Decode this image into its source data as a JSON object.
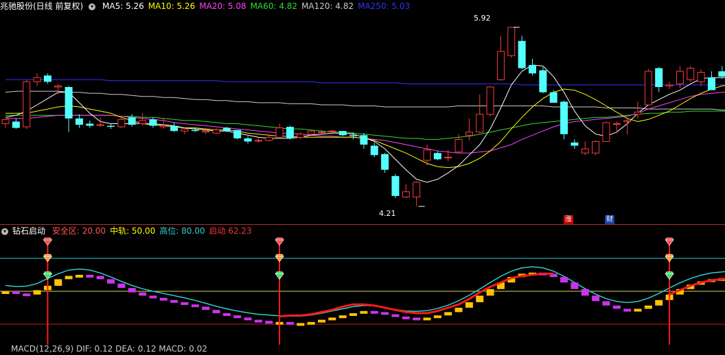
{
  "header": {
    "stock_title": "兆驰股份(日线 前复权)",
    "ma_items": [
      {
        "label": "MA5: 5.26",
        "color": "#ffffff"
      },
      {
        "label": "MA10: 5.26",
        "color": "#ffff00"
      },
      {
        "label": "MA20: 5.08",
        "color": "#ff44ff"
      },
      {
        "label": "MA60: 4.82",
        "color": "#33dd33"
      },
      {
        "label": "MA120: 4.82",
        "color": "#cccccc"
      },
      {
        "label": "MA250: 5.03",
        "color": "#3333ff"
      }
    ]
  },
  "indicator_header": {
    "name": "钻石启动",
    "items": [
      {
        "label": "安全区: 20.00",
        "color": "#ff5555"
      },
      {
        "label": "中轨: 50.00",
        "color": "#ffff00"
      },
      {
        "label": "高位: 80.00",
        "color": "#33cccc"
      },
      {
        "label": "启动  62.23",
        "color": "#ff3333"
      }
    ]
  },
  "bottom_header": {
    "text": "MACD(12,26,9) DIF: 0.12  DEA: 0.12  MACD: 0.02"
  },
  "annotations": {
    "high_label": "5.92",
    "low_label": "4.21",
    "badge_zhang": "涨",
    "badge_cai": "财"
  },
  "chart_data": [
    {
      "type": "candlestick",
      "title": "兆驰股份(日线 前复权)",
      "ylim": [
        4.1,
        6.05
      ],
      "candles": [
        [
          5.0,
          5.04,
          4.96,
          5.02
        ],
        [
          5.02,
          4.96,
          4.95,
          5.05
        ],
        [
          4.97,
          5.4,
          4.95,
          5.42
        ],
        [
          5.4,
          5.44,
          5.36,
          5.48
        ],
        [
          5.46,
          5.4,
          5.38,
          5.48
        ],
        [
          5.35,
          5.36,
          5.28,
          5.38
        ],
        [
          5.35,
          5.05,
          4.92,
          5.36
        ],
        [
          5.05,
          4.99,
          4.96,
          5.09
        ],
        [
          5.0,
          4.98,
          4.96,
          5.03
        ],
        [
          4.99,
          4.99,
          4.97,
          5.06
        ],
        [
          4.98,
          4.97,
          4.95,
          5.0
        ],
        [
          4.97,
          5.04,
          4.96,
          5.06
        ],
        [
          5.06,
          4.99,
          4.97,
          5.09
        ],
        [
          5.0,
          5.03,
          4.98,
          5.1
        ],
        [
          5.04,
          4.98,
          4.96,
          5.06
        ],
        [
          4.97,
          4.98,
          4.95,
          5.05
        ],
        [
          4.98,
          4.93,
          4.92,
          5.01
        ],
        [
          4.93,
          4.95,
          4.9,
          4.96
        ],
        [
          4.94,
          4.93,
          4.92,
          4.96
        ],
        [
          4.92,
          4.93,
          4.9,
          4.96
        ],
        [
          4.91,
          4.94,
          4.9,
          4.96
        ],
        [
          4.96,
          4.93,
          4.92,
          4.97
        ],
        [
          4.94,
          4.86,
          4.85,
          4.94
        ],
        [
          4.86,
          4.83,
          4.81,
          4.88
        ],
        [
          4.84,
          4.84,
          4.82,
          4.87
        ],
        [
          4.84,
          4.87,
          4.83,
          4.9
        ],
        [
          4.87,
          4.96,
          4.86,
          5.0
        ],
        [
          4.97,
          4.86,
          4.85,
          4.98
        ],
        [
          4.87,
          4.9,
          4.85,
          4.92
        ],
        [
          4.9,
          4.93,
          4.89,
          4.94
        ],
        [
          4.92,
          4.92,
          4.9,
          4.94
        ],
        [
          4.93,
          4.93,
          4.91,
          4.94
        ],
        [
          4.93,
          4.89,
          4.88,
          4.93
        ],
        [
          4.89,
          4.88,
          4.85,
          4.92
        ],
        [
          4.89,
          4.8,
          4.76,
          4.91
        ],
        [
          4.79,
          4.7,
          4.68,
          4.82
        ],
        [
          4.71,
          4.56,
          4.53,
          4.72
        ],
        [
          4.5,
          4.31,
          4.29,
          4.52
        ],
        [
          4.3,
          4.35,
          4.29,
          4.42
        ],
        [
          4.3,
          4.44,
          4.21,
          4.45
        ],
        [
          4.65,
          4.75,
          4.6,
          4.8
        ],
        [
          4.72,
          4.66,
          4.65,
          4.74
        ],
        [
          4.68,
          4.68,
          4.64,
          4.75
        ],
        [
          4.73,
          4.85,
          4.72,
          4.9
        ],
        [
          4.89,
          4.92,
          4.84,
          5.05
        ],
        [
          4.92,
          5.09,
          4.91,
          5.28
        ],
        [
          5.09,
          5.35,
          5.07,
          5.36
        ],
        [
          5.42,
          5.69,
          5.41,
          5.84
        ],
        [
          5.65,
          5.92,
          5.63,
          5.92
        ],
        [
          5.79,
          5.53,
          5.52,
          5.84
        ],
        [
          5.56,
          5.48,
          5.46,
          5.62
        ],
        [
          5.51,
          5.3,
          5.29,
          5.54
        ],
        [
          5.3,
          5.2,
          5.2,
          5.32
        ],
        [
          5.21,
          4.9,
          4.85,
          5.22
        ],
        [
          4.82,
          4.79,
          4.76,
          4.85
        ],
        [
          4.72,
          4.76,
          4.7,
          4.83
        ],
        [
          4.72,
          4.83,
          4.7,
          4.84
        ],
        [
          4.83,
          5.01,
          4.83,
          5.02
        ],
        [
          5.0,
          5.0,
          4.91,
          5.02
        ],
        [
          5.02,
          5.03,
          4.9,
          5.05
        ],
        [
          5.09,
          5.11,
          5.05,
          5.21
        ],
        [
          5.18,
          5.5,
          5.18,
          5.52
        ],
        [
          5.53,
          5.35,
          5.3,
          5.54
        ],
        [
          5.36,
          5.37,
          5.33,
          5.4
        ],
        [
          5.38,
          5.5,
          5.34,
          5.55
        ],
        [
          5.42,
          5.53,
          5.4,
          5.55
        ],
        [
          5.4,
          5.49,
          5.36,
          5.52
        ],
        [
          5.44,
          5.32,
          5.32,
          5.5
        ],
        [
          5.5,
          5.45,
          5.43,
          5.55
        ],
        [
          5.56,
          5.5,
          5.35,
          5.56
        ],
        [
          5.48,
          5.5,
          5.36,
          5.52
        ],
        [
          5.5,
          5.59,
          5.49,
          5.62
        ]
      ],
      "lines": [
        {
          "name": "MA5",
          "color": "#ffffff",
          "values": [
            5.06,
            5.08,
            5.12,
            5.18,
            5.24,
            5.3,
            5.3,
            5.2,
            5.1,
            5.02,
            5.0,
            5.0,
            5.0,
            5.0,
            5.0,
            4.99,
            4.98,
            4.96,
            4.95,
            4.94,
            4.93,
            4.93,
            4.91,
            4.89,
            4.87,
            4.86,
            4.86,
            4.86,
            4.87,
            4.89,
            4.9,
            4.91,
            4.91,
            4.9,
            4.87,
            4.83,
            4.76,
            4.66,
            4.56,
            4.47,
            4.44,
            4.47,
            4.53,
            4.6,
            4.7,
            4.8,
            4.95,
            5.15,
            5.37,
            5.5,
            5.56,
            5.55,
            5.45,
            5.3,
            5.12,
            4.98,
            4.9,
            4.88,
            4.92,
            5.0,
            5.1,
            5.18,
            5.23,
            5.28,
            5.32,
            5.38,
            5.43,
            5.44,
            5.44,
            5.44,
            5.46,
            5.49
          ]
        },
        {
          "name": "MA10",
          "color": "#ffff00",
          "values": [
            5.1,
            5.1,
            5.1,
            5.12,
            5.14,
            5.16,
            5.17,
            5.16,
            5.14,
            5.12,
            5.1,
            5.06,
            5.03,
            5.0,
            4.99,
            4.98,
            4.97,
            4.96,
            4.96,
            4.95,
            4.94,
            4.94,
            4.93,
            4.91,
            4.9,
            4.89,
            4.88,
            4.88,
            4.87,
            4.87,
            4.87,
            4.87,
            4.87,
            4.87,
            4.86,
            4.84,
            4.8,
            4.76,
            4.72,
            4.67,
            4.62,
            4.59,
            4.58,
            4.59,
            4.62,
            4.67,
            4.74,
            4.83,
            4.95,
            5.06,
            5.16,
            5.24,
            5.3,
            5.33,
            5.32,
            5.28,
            5.23,
            5.17,
            5.11,
            5.05,
            5.02,
            5.04,
            5.08,
            5.12,
            5.18,
            5.24,
            5.29,
            5.33,
            5.36,
            5.38,
            5.41,
            5.44
          ]
        },
        {
          "name": "MA20",
          "color": "#ff44ff",
          "values": [
            5.05,
            5.05,
            5.05,
            5.06,
            5.07,
            5.08,
            5.08,
            5.08,
            5.08,
            5.08,
            5.08,
            5.07,
            5.06,
            5.05,
            5.04,
            5.03,
            5.01,
            5.0,
            4.99,
            4.98,
            4.97,
            4.96,
            4.95,
            4.94,
            4.93,
            4.92,
            4.91,
            4.91,
            4.9,
            4.89,
            4.88,
            4.88,
            4.87,
            4.87,
            4.86,
            4.85,
            4.84,
            4.82,
            4.8,
            4.78,
            4.76,
            4.74,
            4.73,
            4.72,
            4.72,
            4.73,
            4.74,
            4.77,
            4.8,
            4.85,
            4.89,
            4.93,
            4.97,
            5.0,
            5.02,
            5.03,
            5.04,
            5.05,
            5.06,
            5.07,
            5.1,
            5.14,
            5.17,
            5.2,
            5.23,
            5.26,
            5.28,
            5.29,
            5.3,
            5.3,
            5.3,
            5.3
          ]
        },
        {
          "name": "MA60",
          "color": "#33dd33",
          "values": [
            5.08,
            5.08,
            5.08,
            5.08,
            5.08,
            5.08,
            5.08,
            5.08,
            5.08,
            5.08,
            5.08,
            5.07,
            5.07,
            5.06,
            5.06,
            5.05,
            5.04,
            5.03,
            5.03,
            5.02,
            5.01,
            5.0,
            5.0,
            4.99,
            4.98,
            4.97,
            4.96,
            4.95,
            4.95,
            4.94,
            4.93,
            4.92,
            4.92,
            4.91,
            4.9,
            4.89,
            4.88,
            4.87,
            4.86,
            4.86,
            4.85,
            4.85,
            4.86,
            4.87,
            4.88,
            4.9,
            4.92,
            4.94,
            4.96,
            4.98,
            5.0,
            5.01,
            5.02,
            5.03,
            5.04,
            5.05,
            5.06,
            5.06,
            5.07,
            5.08,
            5.09,
            5.1,
            5.1,
            5.11,
            5.11,
            5.12,
            5.12,
            5.12,
            5.12,
            5.12,
            5.12,
            5.13
          ]
        },
        {
          "name": "MA120",
          "color": "#cccccc",
          "values": [
            5.3,
            5.31,
            5.31,
            5.31,
            5.31,
            5.31,
            5.3,
            5.3,
            5.29,
            5.29,
            5.28,
            5.28,
            5.27,
            5.26,
            5.26,
            5.25,
            5.25,
            5.24,
            5.23,
            5.23,
            5.22,
            5.22,
            5.21,
            5.21,
            5.2,
            5.2,
            5.2,
            5.19,
            5.19,
            5.19,
            5.18,
            5.18,
            5.18,
            5.17,
            5.17,
            5.17,
            5.16,
            5.16,
            5.16,
            5.16,
            5.16,
            5.16,
            5.16,
            5.17,
            5.17,
            5.17,
            5.17,
            5.17,
            5.17,
            5.17,
            5.17,
            5.17,
            5.16,
            5.16,
            5.16,
            5.16,
            5.16,
            5.15,
            5.15,
            5.15,
            5.15,
            5.14,
            5.14,
            5.14,
            5.14,
            5.14,
            5.14,
            5.14,
            5.13,
            5.13,
            5.13,
            5.13
          ]
        },
        {
          "name": "MA250",
          "color": "#3333ff",
          "values": [
            5.42,
            5.42,
            5.42,
            5.42,
            5.42,
            5.42,
            5.42,
            5.42,
            5.42,
            5.42,
            5.41,
            5.41,
            5.41,
            5.41,
            5.41,
            5.41,
            5.41,
            5.41,
            5.41,
            5.41,
            5.41,
            5.4,
            5.4,
            5.4,
            5.4,
            5.4,
            5.4,
            5.4,
            5.4,
            5.4,
            5.39,
            5.39,
            5.39,
            5.39,
            5.39,
            5.39,
            5.39,
            5.39,
            5.38,
            5.38,
            5.38,
            5.38,
            5.38,
            5.38,
            5.38,
            5.38,
            5.38,
            5.38,
            5.38,
            5.37,
            5.37,
            5.37,
            5.37,
            5.37,
            5.37,
            5.37,
            5.37,
            5.37,
            5.37,
            5.37,
            5.37,
            5.37,
            5.37,
            5.37,
            5.37,
            5.37,
            5.37,
            5.37,
            5.37,
            5.37,
            5.37,
            5.37
          ]
        }
      ]
    },
    {
      "type": "bar",
      "title": "钻石启动",
      "ylim": [
        0,
        100
      ],
      "reference_lines": [
        20,
        50,
        80
      ],
      "values": [
        50,
        48,
        47,
        51,
        55,
        61,
        64,
        65,
        64,
        61,
        57,
        53,
        49,
        46,
        44,
        42,
        40,
        38,
        36,
        33,
        30,
        28,
        26,
        24,
        23,
        22,
        22,
        21,
        21,
        22,
        24,
        26,
        28,
        30,
        32,
        31,
        29,
        27,
        26,
        25,
        26,
        28,
        31,
        35,
        40,
        46,
        52,
        58,
        63,
        66,
        67,
        66,
        63,
        58,
        52,
        46,
        41,
        37,
        34,
        33,
        34,
        37,
        42,
        47,
        52,
        56,
        59,
        61,
        62,
        62,
        63,
        62
      ],
      "signal_line": [
        0,
        0,
        0,
        0,
        0,
        0,
        0,
        0,
        0,
        0,
        0,
        0,
        0,
        0,
        0,
        0,
        0,
        0,
        0,
        0,
        0,
        0,
        0,
        0,
        0,
        0,
        27,
        28,
        28,
        29,
        31,
        33,
        36,
        38,
        38,
        37,
        35,
        33,
        31,
        30,
        30,
        32,
        35,
        38,
        43,
        49,
        54,
        58,
        62,
        64,
        65,
        66,
        66,
        0,
        0,
        0,
        0,
        0,
        0,
        0,
        0,
        0,
        0,
        47,
        51,
        55,
        58,
        60,
        61,
        62,
        62,
        62
      ],
      "signals": [
        4,
        26,
        63,
        71
      ]
    }
  ]
}
